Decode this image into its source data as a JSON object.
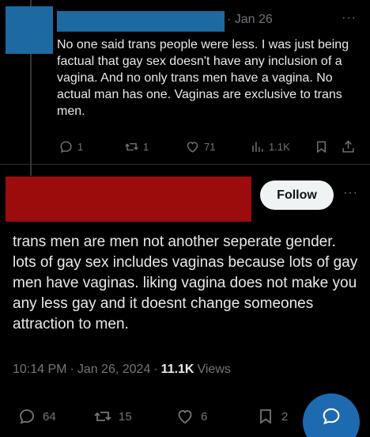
{
  "reply": {
    "date": "· Jan 26",
    "more": "···",
    "text": "No one said trans people were less. I was just being factual that gay sex doesn't have any inclusion of a vagina. And no only trans men have a vagina. No actual man has one. Vaginas are exclusive to trans men.",
    "stats": {
      "replies": "1",
      "reposts": "1",
      "likes": "71",
      "views": "1.1K"
    }
  },
  "main_post": {
    "follow_label": "Follow",
    "more": "···",
    "text": "trans men are men not another seperate gender. lots of gay sex includes vaginas because lots of gay men have vaginas. liking vagina does not make you any less gay and it doesnt change someones attraction to men.",
    "time": "10:14 PM",
    "dot": "·",
    "date": "Jan 26, 2024",
    "views_count": "11.1K",
    "views_label": "Views",
    "stats": {
      "replies": "64",
      "reposts": "15",
      "likes": "6",
      "bookmarks": "2"
    }
  },
  "colors": {
    "background": "#000000",
    "text": "#e7e9ea",
    "muted": "#71767b",
    "redact_blue": "#1c6aa1",
    "redact_red": "#9c0c0c",
    "fab": "#1d6ab0"
  }
}
